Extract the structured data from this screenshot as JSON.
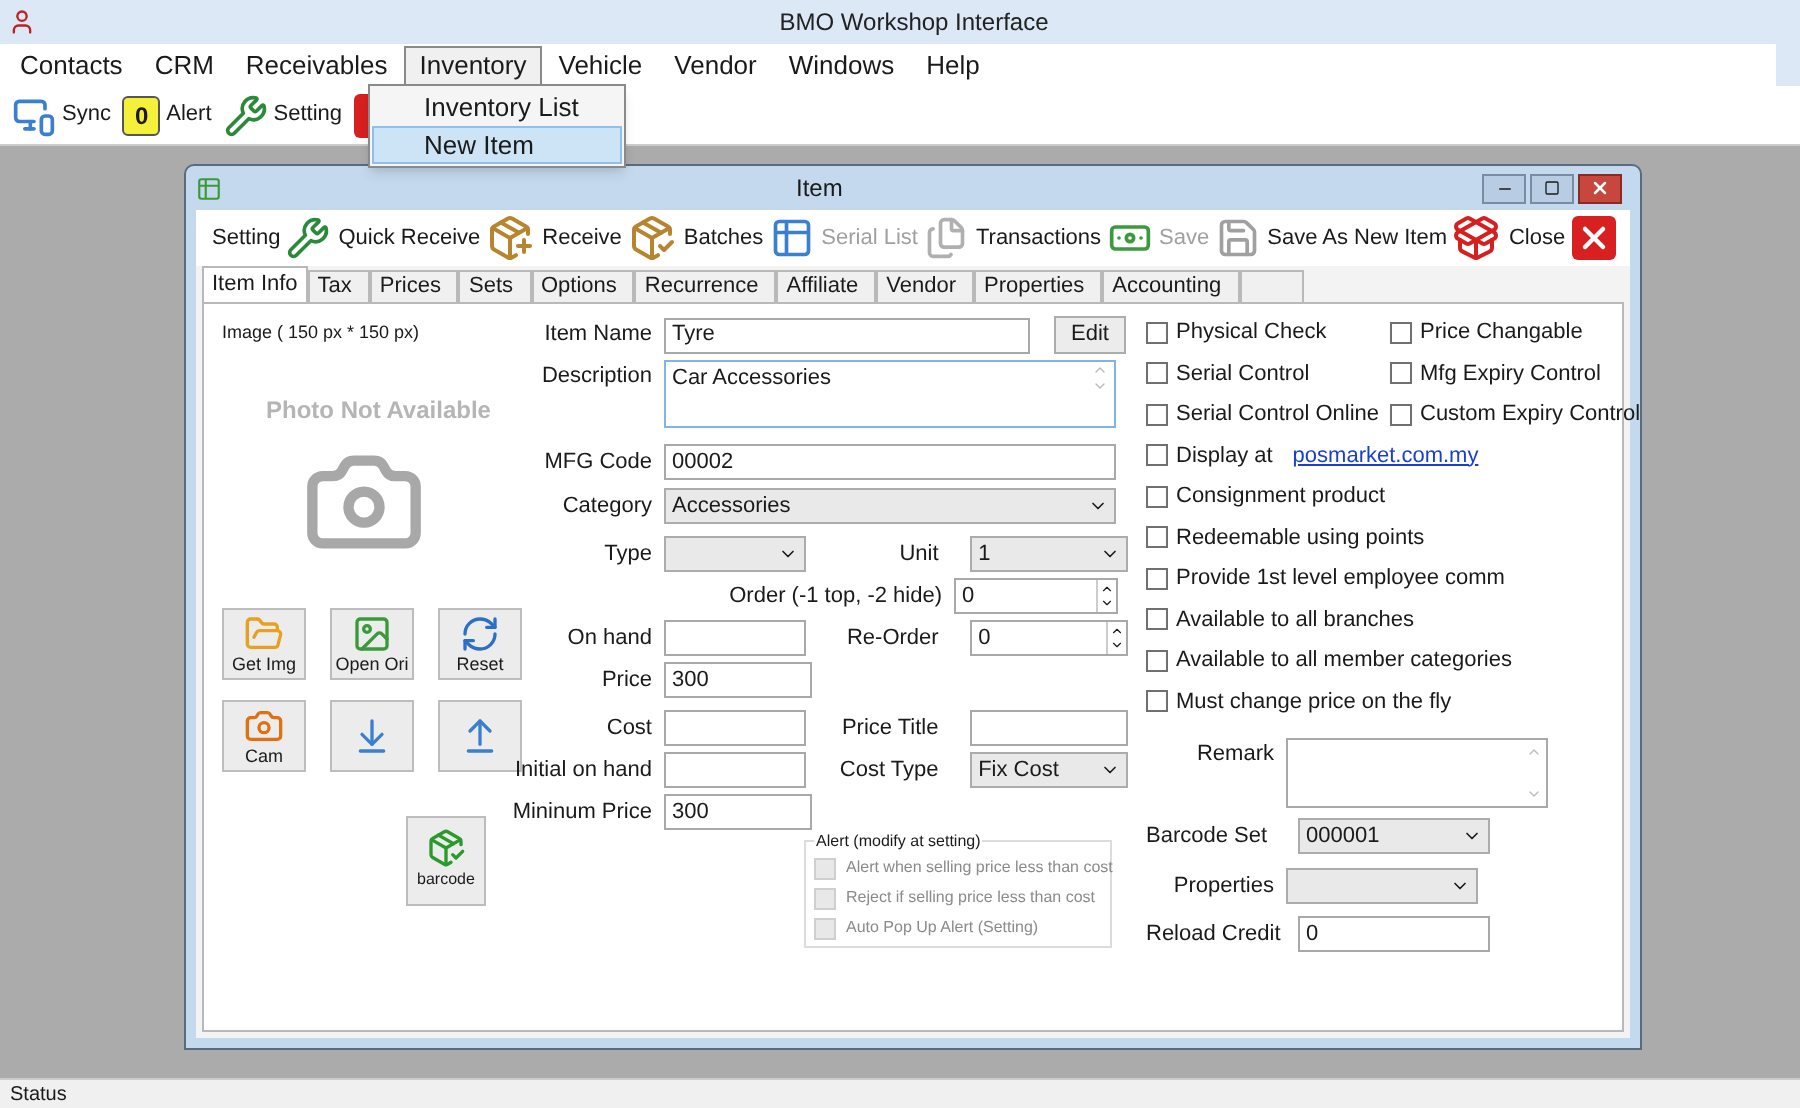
{
  "window": {
    "title": "BMO Workshop Interface"
  },
  "menu": [
    {
      "label": "Contacts",
      "selected": false
    },
    {
      "label": "CRM",
      "selected": false
    },
    {
      "label": "Receivables",
      "selected": false
    },
    {
      "label": "Inventory",
      "selected": true
    },
    {
      "label": "Vehicle",
      "selected": false
    },
    {
      "label": "Vendor",
      "selected": false
    },
    {
      "label": "Windows",
      "selected": false
    },
    {
      "label": "Help",
      "selected": false
    }
  ],
  "dropdown": [
    {
      "label": "Inventory List",
      "selected": false
    },
    {
      "label": "New Item",
      "selected": true
    }
  ],
  "toolbar": [
    {
      "label": "Sync",
      "kind": "sync"
    },
    {
      "label": "Alert",
      "kind": "alert",
      "badge": "0"
    },
    {
      "label": "Setting",
      "kind": "setting"
    }
  ],
  "item_window": {
    "title": "Item",
    "toolbar": [
      {
        "label": "Setting",
        "disabled": false
      },
      {
        "label": "Quick Receive",
        "disabled": false
      },
      {
        "label": "Receive",
        "disabled": false
      },
      {
        "label": "Batches",
        "disabled": false
      },
      {
        "label": "Serial List",
        "disabled": true
      },
      {
        "label": "Transactions",
        "disabled": false
      },
      {
        "label": "Save",
        "disabled": true
      },
      {
        "label": "Save As New Item",
        "disabled": false
      },
      {
        "label": "Close",
        "disabled": false
      }
    ],
    "tabs": [
      {
        "label": "Item Info",
        "selected": true
      },
      {
        "label": "Tax",
        "selected": false
      },
      {
        "label": "Prices",
        "selected": false
      },
      {
        "label": "Sets",
        "selected": false
      },
      {
        "label": "Options",
        "selected": false
      },
      {
        "label": "Recurrence",
        "selected": false
      },
      {
        "label": "Affiliate",
        "selected": false
      },
      {
        "label": "Vendor",
        "selected": false
      },
      {
        "label": "Properties",
        "selected": false
      },
      {
        "label": "Accounting",
        "selected": false
      }
    ],
    "image_label": "Image ( 150 px * 150 px)",
    "photo_text": "Photo Not Available",
    "image_buttons": [
      {
        "label": "Get Img",
        "kind": "folder"
      },
      {
        "label": "Open Ori",
        "kind": "photo"
      },
      {
        "label": "Reset",
        "kind": "refresh"
      },
      {
        "label": "Cam",
        "kind": "camera"
      },
      {
        "kind": "photo-down"
      },
      {
        "kind": "photo-up"
      }
    ],
    "barcode_button": "barcode",
    "item_name": {
      "label": "Item Name",
      "value": "Tyre"
    },
    "edit_button": "Edit",
    "description": {
      "label": "Description",
      "value": "Car Accessories"
    },
    "mfg_code": {
      "label": "MFG Code",
      "value": "00002"
    },
    "category": {
      "label": "Category",
      "value": "Accessories"
    },
    "type": {
      "label": "Type"
    },
    "unit": {
      "label": "Unit",
      "value": "1"
    },
    "order": {
      "label": "Order (-1 top, -2 hide)",
      "value": "0"
    },
    "on_hand": {
      "label": "On hand"
    },
    "reorder": {
      "label": "Re-Order",
      "value": "0"
    },
    "price": {
      "label": "Price",
      "value": "300"
    },
    "cost": {
      "label": "Cost"
    },
    "price_title": {
      "label": "Price Title"
    },
    "initial_on_hand": {
      "label": "Initial on hand"
    },
    "cost_type": {
      "label": "Cost Type",
      "value": "Fix Cost"
    },
    "minimum_price": {
      "label": "Mininum Price",
      "value": "300"
    },
    "alert_group": {
      "title": "Alert (modify at setting)",
      "options": [
        {
          "label": "Alert when selling price less than cost",
          "checked": false,
          "disabled": true
        },
        {
          "label": "Reject if selling price less than cost",
          "checked": false,
          "disabled": true
        },
        {
          "label": "Auto Pop Up Alert (Setting)",
          "checked": false,
          "disabled": true
        }
      ]
    },
    "checkboxes": [
      {
        "label": "Physical Check",
        "checked": false
      },
      {
        "label": "Price Changable",
        "checked": false
      },
      {
        "label": "Serial Control",
        "checked": false
      },
      {
        "label": "Mfg Expiry Control",
        "checked": false
      },
      {
        "label": "Serial Control Online",
        "checked": false
      },
      {
        "label": "Custom Expiry Control",
        "checked": false
      }
    ],
    "display_at": {
      "label": "Display at",
      "link": "posmarket.com.my",
      "checked": false
    },
    "more_checkboxes": [
      {
        "label": "Consignment product",
        "checked": false
      },
      {
        "label": "Redeemable using points",
        "checked": false
      },
      {
        "label": "Provide 1st level employee comm",
        "checked": false
      },
      {
        "label": "Available to all branches",
        "checked": false
      },
      {
        "label": "Available to all member categories",
        "checked": false
      },
      {
        "label": "Must change price on the fly",
        "checked": false
      }
    ],
    "remark": {
      "label": "Remark"
    },
    "barcode_set": {
      "label": "Barcode Set",
      "value": "000001"
    },
    "properties": {
      "label": "Properties"
    },
    "reload_credit": {
      "label": "Reload Credit",
      "value": "0"
    }
  },
  "status_bar": "Status"
}
